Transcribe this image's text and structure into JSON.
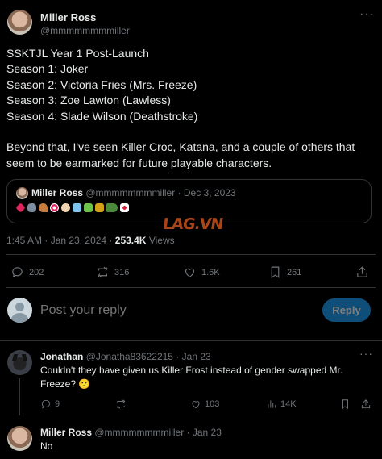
{
  "main_post": {
    "author_name": "Miller Ross",
    "author_handle": "@mmmmmmmmiller",
    "text": "SSKTJL Year 1 Post-Launch\nSeason 1: Joker\nSeason 2: Victoria Fries (Mrs. Freeze)\nSeason 3: Zoe Lawton (Lawless)\nSeason 4: Slade Wilson (Deathstroke)\n\nBeyond that, I've seen Killer Croc, Katana, and a couple of others that seem to be earmarked for future playable characters.",
    "quote": {
      "author_name": "Miller Ross",
      "author_handle": "@mmmmmmmmiller",
      "date": "· Dec 3, 2023"
    },
    "timestamp": "1:45 AM · Jan 23, 2024 ·",
    "views_count": "253.4K",
    "views_label": "Views",
    "actions": {
      "replies": "202",
      "reposts": "316",
      "likes": "1.6K",
      "bookmarks": "261"
    }
  },
  "watermark": "LAG.VN",
  "composer": {
    "placeholder": "Post your reply",
    "button_label": "Reply"
  },
  "replies": [
    {
      "author_name": "Jonathan",
      "author_handle": "@Jonatha83622215",
      "date": "· Jan 23",
      "text": "Couldn't they have given us Killer Frost instead of gender swapped Mr. Freeze? 🙁",
      "actions": {
        "replies": "9",
        "reposts": "",
        "likes": "103",
        "views": "14K"
      }
    },
    {
      "author_name": "Miller Ross",
      "author_handle": "@mmmmmmmmiller",
      "date": "· Jan 23",
      "text": "No"
    }
  ],
  "colors": {
    "background": "#000000",
    "text": "#e7e9ea",
    "muted": "#71767b",
    "accent": "#1d9bf0",
    "border": "#2f3336"
  }
}
